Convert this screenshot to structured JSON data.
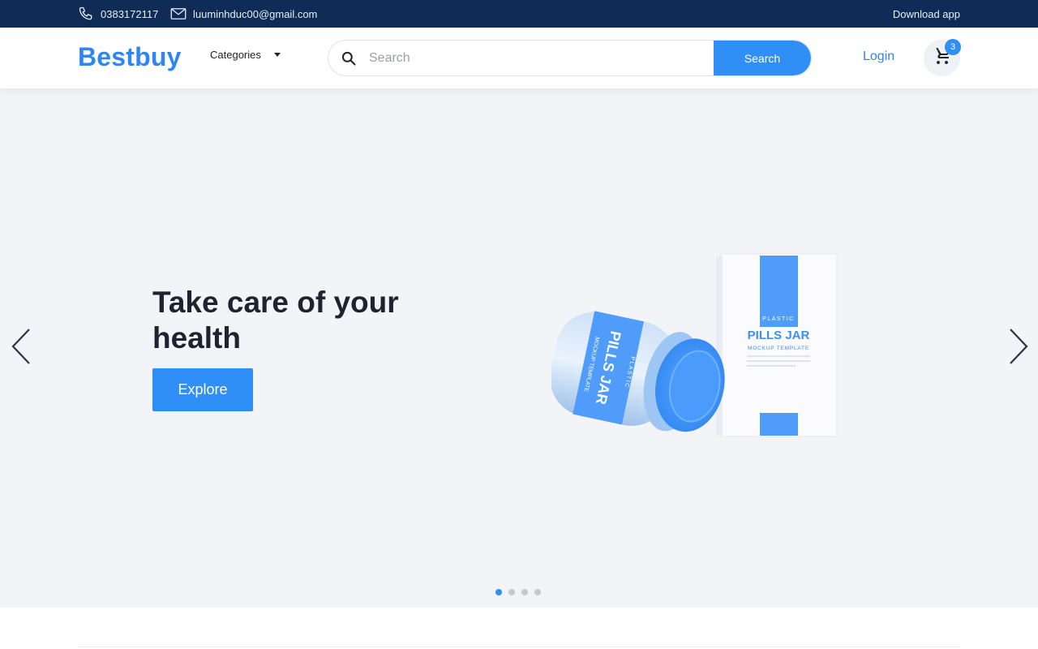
{
  "topbar": {
    "phone": "0383172117",
    "email": "luuminhduc00@gmail.com",
    "download": "Download app"
  },
  "header": {
    "logo": "Bestbuy",
    "categories_label": "Categories",
    "search_placeholder": "Search",
    "search_button": "Search",
    "login": "Login",
    "cart_count": "3"
  },
  "hero": {
    "headline": "Take care of your health",
    "cta": "Explore",
    "product_text": {
      "box_small": "PLASTIC",
      "box_title": "PILLS JAR",
      "box_sub": "MOCKUP TEMPLATE",
      "jar_small": "PLASTIC",
      "jar_title": "PILLS JAR",
      "jar_sub": "MOCKUP TEMPLATE"
    },
    "slides": {
      "total": 4,
      "active": 1
    }
  },
  "colors": {
    "topbar_bg": "#0f2c57",
    "brand_blue": "#2f86f0",
    "button_blue": "#2f8ff7",
    "hero_bg": "#f3f4f7",
    "headline": "#1d2430"
  },
  "icons": {
    "phone": "phone-icon",
    "mail": "mail-icon",
    "search": "search-icon",
    "cart": "cart-icon",
    "prev": "chevron-left-icon",
    "next": "chevron-right-icon"
  }
}
